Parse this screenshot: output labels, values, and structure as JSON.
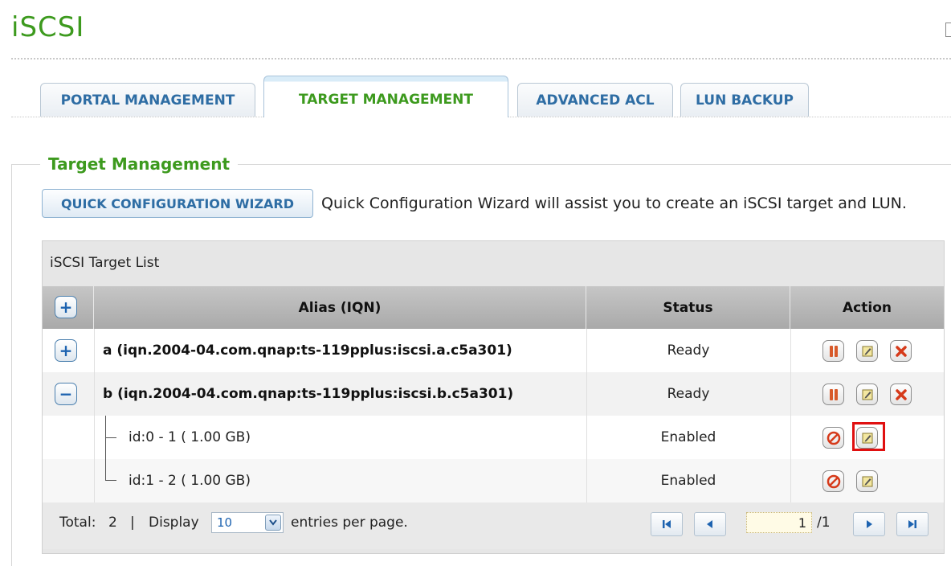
{
  "page": {
    "title": "iSCSI"
  },
  "tabs": [
    {
      "label": "PORTAL MANAGEMENT",
      "active": false
    },
    {
      "label": "TARGET MANAGEMENT",
      "active": true
    },
    {
      "label": "ADVANCED ACL",
      "active": false
    },
    {
      "label": "LUN BACKUP",
      "active": false
    }
  ],
  "section": {
    "legend": "Target Management",
    "wizard_button": "QUICK CONFIGURATION WIZARD",
    "wizard_description": "Quick Configuration Wizard will assist you to create an iSCSI target and LUN."
  },
  "target_list": {
    "title": "iSCSI Target List",
    "columns": {
      "alias": "Alias (IQN)",
      "status": "Status",
      "action": "Action"
    },
    "targets": [
      {
        "alias": "a (iqn.2004-04.com.qnap:ts-119pplus:iscsi.a.c5a301)",
        "status": "Ready",
        "expanded": false
      },
      {
        "alias": "b (iqn.2004-04.com.qnap:ts-119pplus:iscsi.b.c5a301)",
        "status": "Ready",
        "expanded": true,
        "luns": [
          {
            "label": "id:0 - 1 ( 1.00 GB)",
            "status": "Enabled"
          },
          {
            "label": "id:1 - 2 ( 1.00 GB)",
            "status": "Enabled"
          }
        ]
      }
    ]
  },
  "footer": {
    "total_label": "Total:",
    "total_value": "2",
    "separator": "|",
    "display_label": "Display",
    "per_page": "10",
    "entries_label": "entries per page.",
    "current_page": "1",
    "page_count": "/1"
  },
  "colors": {
    "accent_green": "#3d9a1e",
    "link_blue": "#2e6da4",
    "highlight_red": "#e01010"
  },
  "icons": [
    "plus-icon",
    "minus-icon",
    "pause-icon",
    "edit-icon",
    "delete-icon",
    "disable-icon",
    "first-page-icon",
    "prev-page-icon",
    "next-page-icon",
    "last-page-icon",
    "dropdown-arrow-icon"
  ]
}
